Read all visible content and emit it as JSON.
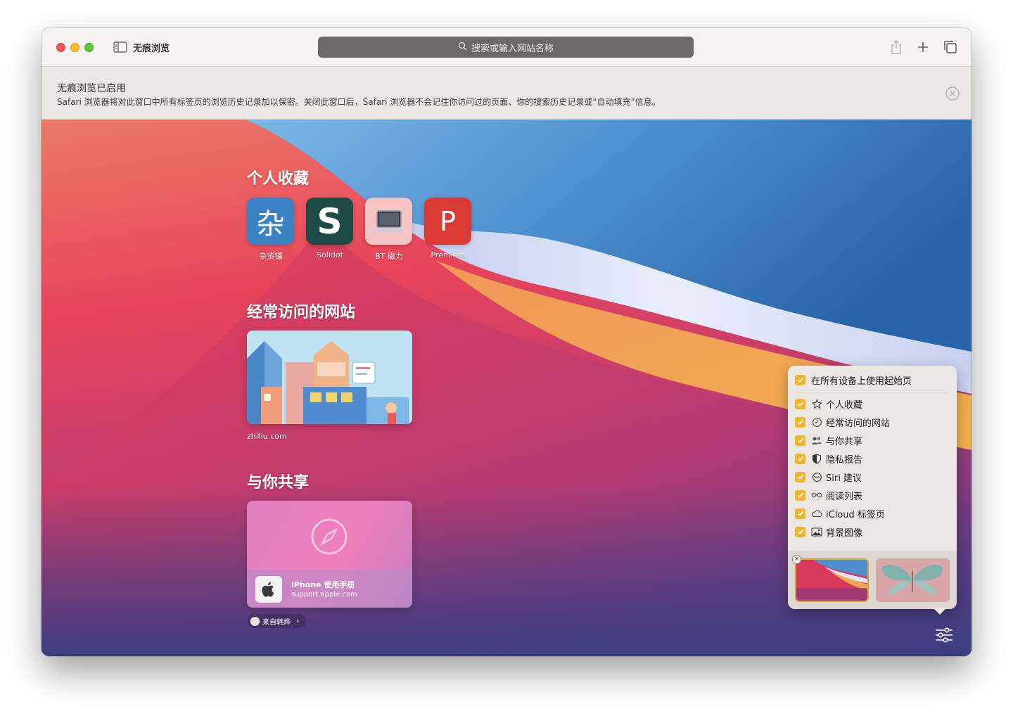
{
  "window": {
    "title": "无痕浏览",
    "address_placeholder": "搜索或输入网站名称"
  },
  "banner": {
    "title": "无痕浏览已启用",
    "text": "Safari 浏览器将对此窗口中所有标签页的浏览历史记录加以保密。关闭此窗口后，Safari 浏览器不会记住你访问过的页面、你的搜索历史记录或“自动填充”信息。"
  },
  "favorites": {
    "title": "个人收藏",
    "items": [
      {
        "label": "杂货铺",
        "glyph": "杂",
        "color": "#3b82c4"
      },
      {
        "label": "Solidot",
        "glyph": "S",
        "color": "#1f4b46"
      },
      {
        "label": "BT 磁力",
        "glyph": "",
        "color": "#f4c4c4"
      },
      {
        "label": "Premiere",
        "glyph": "P",
        "color": "#d93a36"
      }
    ]
  },
  "frequent": {
    "title": "经常访问的网站",
    "items": [
      {
        "label": "zhihu.com"
      }
    ]
  },
  "shared": {
    "title": "与你共享",
    "card_title": "iPhone 使用手册",
    "card_url": "support.apple.com",
    "from_label": "来自韩烨"
  },
  "customize": {
    "master_label": "在所有设备上使用起始页",
    "options": [
      {
        "label": "个人收藏",
        "icon": "star-icon",
        "checked": true
      },
      {
        "label": "经常访问的网站",
        "icon": "clock-icon",
        "checked": true
      },
      {
        "label": "与你共享",
        "icon": "people-icon",
        "checked": true
      },
      {
        "label": "隐私报告",
        "icon": "shield-icon",
        "checked": true
      },
      {
        "label": "Siri 建议",
        "icon": "siri-icon",
        "checked": true
      },
      {
        "label": "阅读列表",
        "icon": "glasses-icon",
        "checked": true
      },
      {
        "label": "iCloud 标签页",
        "icon": "cloud-icon",
        "checked": true
      },
      {
        "label": "背景图像",
        "icon": "image-icon",
        "checked": true
      }
    ]
  },
  "colors": {
    "accent": "#f0b52d",
    "address_bar": "#6b6967"
  }
}
